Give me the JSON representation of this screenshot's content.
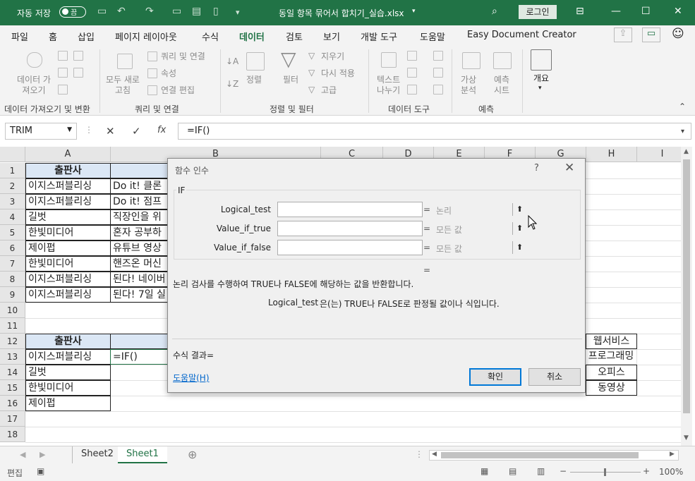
{
  "titlebar": {
    "autosave_label": "자동 저장",
    "autosave_state": "끔",
    "document_title": "동일 항목 묶어서 합치기_실습.xlsx",
    "login_label": "로그인",
    "color": "#217346"
  },
  "ribbon_tabs": [
    "파일",
    "홈",
    "삽입",
    "페이지 레이아웃",
    "수식",
    "데이터",
    "검토",
    "보기",
    "개발 도구",
    "도움말",
    "Easy Document Creator"
  ],
  "active_tab": "데이터",
  "ribbon": {
    "get_data": "데이터 가\n져오기",
    "refresh_all": "모두 새로\n고침",
    "queries_connections": "쿼리 및 연결",
    "properties": "속성",
    "edit_links": "연결 편집",
    "sort": "정렬",
    "filter": "필터",
    "clear": "지우기",
    "reapply": "다시 적용",
    "advanced": "고급",
    "text_to_columns": "텍스트\n나누기",
    "what_if": "가상\n분석",
    "forecast_sheet": "예측\n시트",
    "outline": "개요",
    "groups": [
      "데이터 가져오기 및 변환",
      "쿼리 및 연결",
      "정렬 및 필터",
      "데이터 도구",
      "예측"
    ]
  },
  "formula_bar": {
    "name_box": "TRIM",
    "formula": "=IF()",
    "fx": "fx"
  },
  "columns": [
    "A",
    "B",
    "C",
    "D",
    "E",
    "F",
    "G",
    "H",
    "I"
  ],
  "rows": [
    "1",
    "2",
    "3",
    "4",
    "5",
    "6",
    "7",
    "8",
    "9",
    "10",
    "11",
    "12",
    "13",
    "14",
    "15",
    "16",
    "17",
    "18"
  ],
  "cells": {
    "a1": "출판사",
    "a2": "이지스퍼블리싱",
    "b2": "Do it! 클론",
    "a3": "이지스퍼블리싱",
    "b3": "Do it! 점프",
    "a4": "길벗",
    "b4": "직장인을 위",
    "a5": "한빛미디어",
    "b5": "혼자 공부하",
    "a6": "제이펍",
    "b6": "유튜브 영상",
    "a7": "한빛미디어",
    "b7": "핸즈온 머신",
    "a8": "이지스퍼블리싱",
    "b8": "된다! 네이버",
    "a9": "이지스퍼블리싱",
    "b9": "된다! 7일 실",
    "a12": "출판사",
    "a13": "이지스퍼블리싱",
    "b13": "=IF()",
    "a14": "길벗",
    "a15": "한빛미디어",
    "a16": "제이펍",
    "h12": "웹서비스",
    "h13": "프로그래밍",
    "h14": "오피스",
    "h15": "동영상"
  },
  "dialog": {
    "title": "함수 인수",
    "help_glyph": "?",
    "function_name": "IF",
    "args": [
      {
        "name": "Logical_test",
        "value": "논리"
      },
      {
        "name": "Value_if_true",
        "value": "모든 값"
      },
      {
        "name": "Value_if_false",
        "value": "모든 값"
      }
    ],
    "eq": "=",
    "description": "논리 검사를 수행하여 TRUE나 FALSE에 해당하는 값을 반환합니다.",
    "arg_help_name": "Logical_test",
    "arg_help_text": "은(는) TRUE나 FALSE로 판정될 값이나 식입니다.",
    "result_label": "수식 결과=",
    "help_link": "도움말(H)",
    "ok": "확인",
    "cancel": "취소"
  },
  "sheets": [
    "Sheet2",
    "Sheet1"
  ],
  "active_sheet": "Sheet1",
  "status": {
    "mode": "편집",
    "zoom": "100%"
  }
}
